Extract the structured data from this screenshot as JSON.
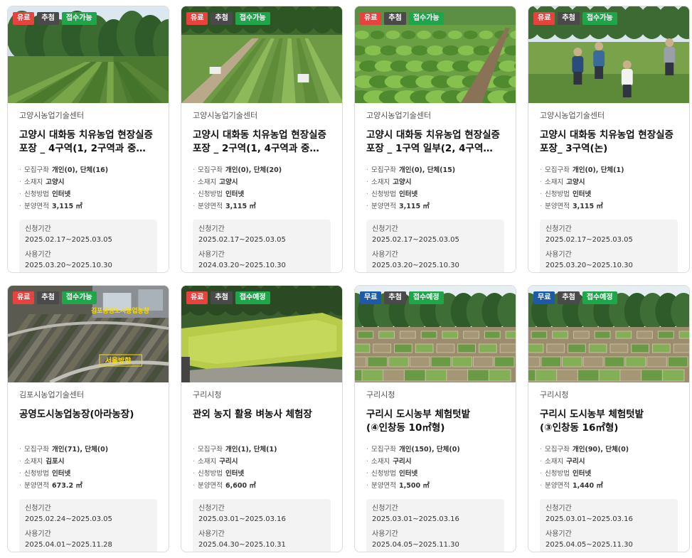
{
  "labels": {
    "recruit_units": "모집구좌",
    "location": "소재지",
    "apply_method": "신청방법",
    "area": "분양면적",
    "apply_period": "신청기간",
    "use_period": "사용기간"
  },
  "cards": [
    {
      "badges": [
        {
          "text": "유료",
          "type": "paid"
        },
        {
          "text": "추첨",
          "type": "lottery"
        },
        {
          "text": "접수가능",
          "type": "open"
        }
      ],
      "image": "garden-rows",
      "org": "고양시농업기술센터",
      "title": "고양시 대화동 치유농업 현장실증 포장 _ 4구역(1, 2구역과 중…",
      "units": "개인(0), 단체(16)",
      "location": "고양시",
      "method": "인터넷",
      "area": "3,115 ㎡",
      "apply": "2025.02.17~2025.03.05",
      "use": "2025.03.20~2025.10.30"
    },
    {
      "badges": [
        {
          "text": "유료",
          "type": "paid"
        },
        {
          "text": "추첨",
          "type": "lottery"
        },
        {
          "text": "접수가능",
          "type": "open"
        }
      ],
      "image": "garden-path",
      "org": "고양시농업기술센터",
      "title": "고양시 대화동 치유농업 현장실증 포장 _ 2구역(1, 4구역과 중…",
      "units": "개인(0), 단체(20)",
      "location": "고양시",
      "method": "인터넷",
      "area": "3,115 ㎡",
      "apply": "2025.02.17~2025.03.05",
      "use": "2024.03.20~2025.10.30"
    },
    {
      "badges": [
        {
          "text": "유료",
          "type": "paid"
        },
        {
          "text": "추첨",
          "type": "lottery"
        },
        {
          "text": "접수가능",
          "type": "open"
        }
      ],
      "image": "cabbage-rows",
      "org": "고양시농업기술센터",
      "title": "고양시 대화동 치유농업 현장실증 포장 _ 1구역 일부(2, 4구역…",
      "units": "개인(0), 단체(15)",
      "location": "고양시",
      "method": "인터넷",
      "area": "3,115 ㎡",
      "apply": "2025.02.17~2025.03.05",
      "use": "2025.03.20~2025.10.30"
    },
    {
      "badges": [
        {
          "text": "유료",
          "type": "paid"
        },
        {
          "text": "추첨",
          "type": "lottery"
        },
        {
          "text": "접수가능",
          "type": "open"
        }
      ],
      "image": "farmers-working",
      "org": "고양시농업기술센터",
      "title": "고양시 대화동 치유농업 현장실증 포장_ 3구역(논)",
      "units": "개인(0), 단체(1)",
      "location": "고양시",
      "method": "인터넷",
      "area": "3,115 ㎡",
      "apply": "2025.02.17~2025.03.05",
      "use": "2025.03.20~2025.10.30"
    },
    {
      "badges": [
        {
          "text": "유료",
          "type": "paid"
        },
        {
          "text": "추첨",
          "type": "lottery"
        },
        {
          "text": "접수가능",
          "type": "open"
        }
      ],
      "image": "aerial-map",
      "map_labels": [
        "김포공영도시농업농장",
        "서울방향"
      ],
      "org": "김포시농업기술센터",
      "title": "공영도시농업농장(아라농장)",
      "units": "개인(71), 단체(0)",
      "location": "김포시",
      "method": "인터넷",
      "area": "673.2 ㎡",
      "apply": "2025.02.24~2025.03.05",
      "use": "2025.04.01~2025.11.28"
    },
    {
      "badges": [
        {
          "text": "유료",
          "type": "paid"
        },
        {
          "text": "추첨",
          "type": "lottery"
        },
        {
          "text": "접수예정",
          "type": "open"
        }
      ],
      "image": "rice-paddy",
      "org": "구리시청",
      "title": "관외 농지 활용 벼농사 체험장",
      "units": "개인(1), 단체(1)",
      "location": "구리시",
      "method": "인터넷",
      "area": "6,600 ㎡",
      "apply": "2025.03.01~2025.03.16",
      "use": "2025.04.30~2025.10.31"
    },
    {
      "badges": [
        {
          "text": "무료",
          "type": "free"
        },
        {
          "text": "추첨",
          "type": "lottery"
        },
        {
          "text": "접수예정",
          "type": "open"
        }
      ],
      "image": "plot-garden",
      "org": "구리시청",
      "title": "구리시 도시농부 체험텃밭(④인창동 10㎡형)",
      "units": "개인(150), 단체(0)",
      "location": "구리시",
      "method": "인터넷",
      "area": "1,500 ㎡",
      "apply": "2025.03.01~2025.03.16",
      "use": "2025.04.05~2025.11.30"
    },
    {
      "badges": [
        {
          "text": "무료",
          "type": "free"
        },
        {
          "text": "추첨",
          "type": "lottery"
        },
        {
          "text": "접수예정",
          "type": "open"
        }
      ],
      "image": "plot-garden",
      "org": "구리시청",
      "title": "구리시 도시농부 체험텃밭(③인창동 16㎡형)",
      "units": "개인(90), 단체(0)",
      "location": "구리시",
      "method": "인터넷",
      "area": "1,440 ㎡",
      "apply": "2025.03.01~2025.03.16",
      "use": "2025.04.05~2025.11.30"
    }
  ]
}
